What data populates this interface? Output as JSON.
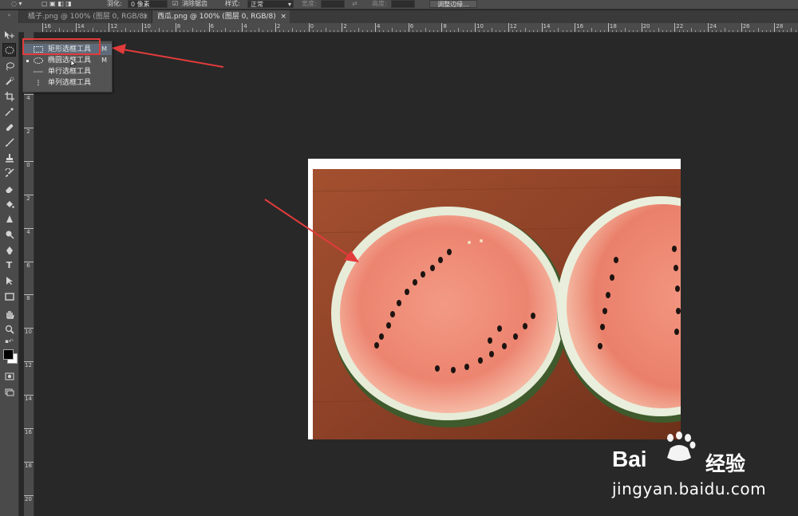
{
  "options_bar": {
    "feather_label": "羽化:",
    "feather_value": "0 像素",
    "antialias_label": "消除锯齿",
    "style_label": "样式:",
    "style_value": "正常",
    "width_label": "宽度:",
    "height_label": "高度:",
    "refine_edge_label": "调整边缘..."
  },
  "tabs": [
    {
      "label": "橘子.png @ 100% (图层 0, RGB/8)",
      "close": "×"
    },
    {
      "label": "西瓜.png @ 100% (图层 0, RGB/8)",
      "close": "×"
    }
  ],
  "ruler_h_ticks": [
    "16",
    "14",
    "12",
    "10",
    "8",
    "6",
    "4",
    "2",
    "0",
    "2",
    "4",
    "6",
    "8",
    "10",
    "12",
    "14",
    "16",
    "18",
    "20",
    "22",
    "24",
    "26",
    "28"
  ],
  "ruler_v_ticks": [
    "4",
    "2",
    "0",
    "2",
    "4",
    "6",
    "8",
    "10",
    "12",
    "14",
    "16",
    "18",
    "20"
  ],
  "flyout": {
    "items": [
      {
        "label": "矩形选框工具",
        "shortcut": "M"
      },
      {
        "label": "椭圆选框工具",
        "shortcut": "M"
      },
      {
        "label": "单行选框工具",
        "shortcut": ""
      },
      {
        "label": "单列选框工具",
        "shortcut": ""
      }
    ]
  },
  "tools": [
    "move-icon",
    "elliptical-marquee-icon",
    "lasso-icon",
    "quick-selection-icon",
    "crop-icon",
    "eyedropper-icon",
    "healing-brush-icon",
    "brush-icon",
    "clone-stamp-icon",
    "history-brush-icon",
    "eraser-icon",
    "paint-bucket-icon",
    "blur-icon",
    "dodge-icon",
    "pen-icon",
    "type-icon",
    "path-selection-icon",
    "rectangle-icon",
    "hand-icon",
    "zoom-icon",
    "default-colors-icon",
    "color-swatches-icon",
    "quick-mask-icon",
    "screen-mode-icon"
  ],
  "watermark": {
    "brand": "Bai",
    "brand_suffix": "经验",
    "url": "jingyan.baidu.com"
  },
  "colors": {
    "highlight": "#e23b3b",
    "foreground": "#000000",
    "background": "#ffffff"
  }
}
